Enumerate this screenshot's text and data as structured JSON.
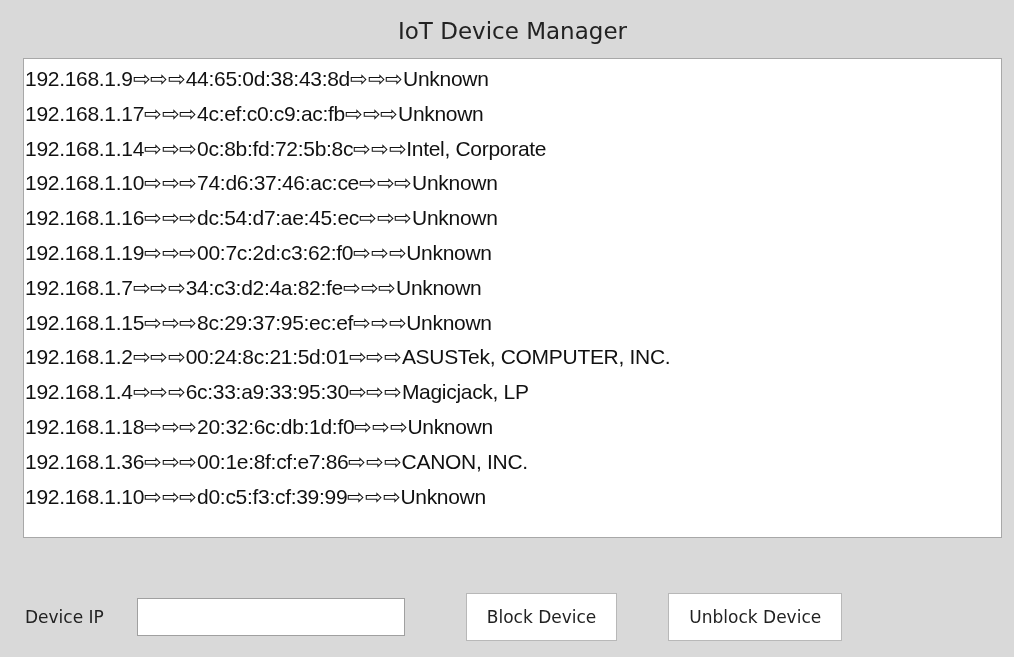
{
  "window": {
    "title": "IoT Device Manager"
  },
  "devices": [
    "192.168.1.9⇨⇨⇨44:65:0d:38:43:8d⇨⇨⇨Unknown",
    "192.168.1.17⇨⇨⇨4c:ef:c0:c9:ac:fb⇨⇨⇨Unknown",
    "192.168.1.14⇨⇨⇨0c:8b:fd:72:5b:8c⇨⇨⇨Intel, Corporate",
    "192.168.1.10⇨⇨⇨74:d6:37:46:ac:ce⇨⇨⇨Unknown",
    "192.168.1.16⇨⇨⇨dc:54:d7:ae:45:ec⇨⇨⇨Unknown",
    "192.168.1.19⇨⇨⇨00:7c:2d:c3:62:f0⇨⇨⇨Unknown",
    "192.168.1.7⇨⇨⇨34:c3:d2:4a:82:fe⇨⇨⇨Unknown",
    "192.168.1.15⇨⇨⇨8c:29:37:95:ec:ef⇨⇨⇨Unknown",
    "192.168.1.2⇨⇨⇨00:24:8c:21:5d:01⇨⇨⇨ASUSTek, COMPUTER, INC.",
    "192.168.1.4⇨⇨⇨6c:33:a9:33:95:30⇨⇨⇨Magicjack, LP",
    "192.168.1.18⇨⇨⇨20:32:6c:db:1d:f0⇨⇨⇨Unknown",
    "192.168.1.36⇨⇨⇨00:1e:8f:cf:e7:86⇨⇨⇨CANON, INC.",
    "192.168.1.10⇨⇨⇨d0:c5:f3:cf:39:99⇨⇨⇨Unknown"
  ],
  "form": {
    "label": "Device IP",
    "buttons": [
      "Block Device",
      "Unblock Device"
    ]
  }
}
